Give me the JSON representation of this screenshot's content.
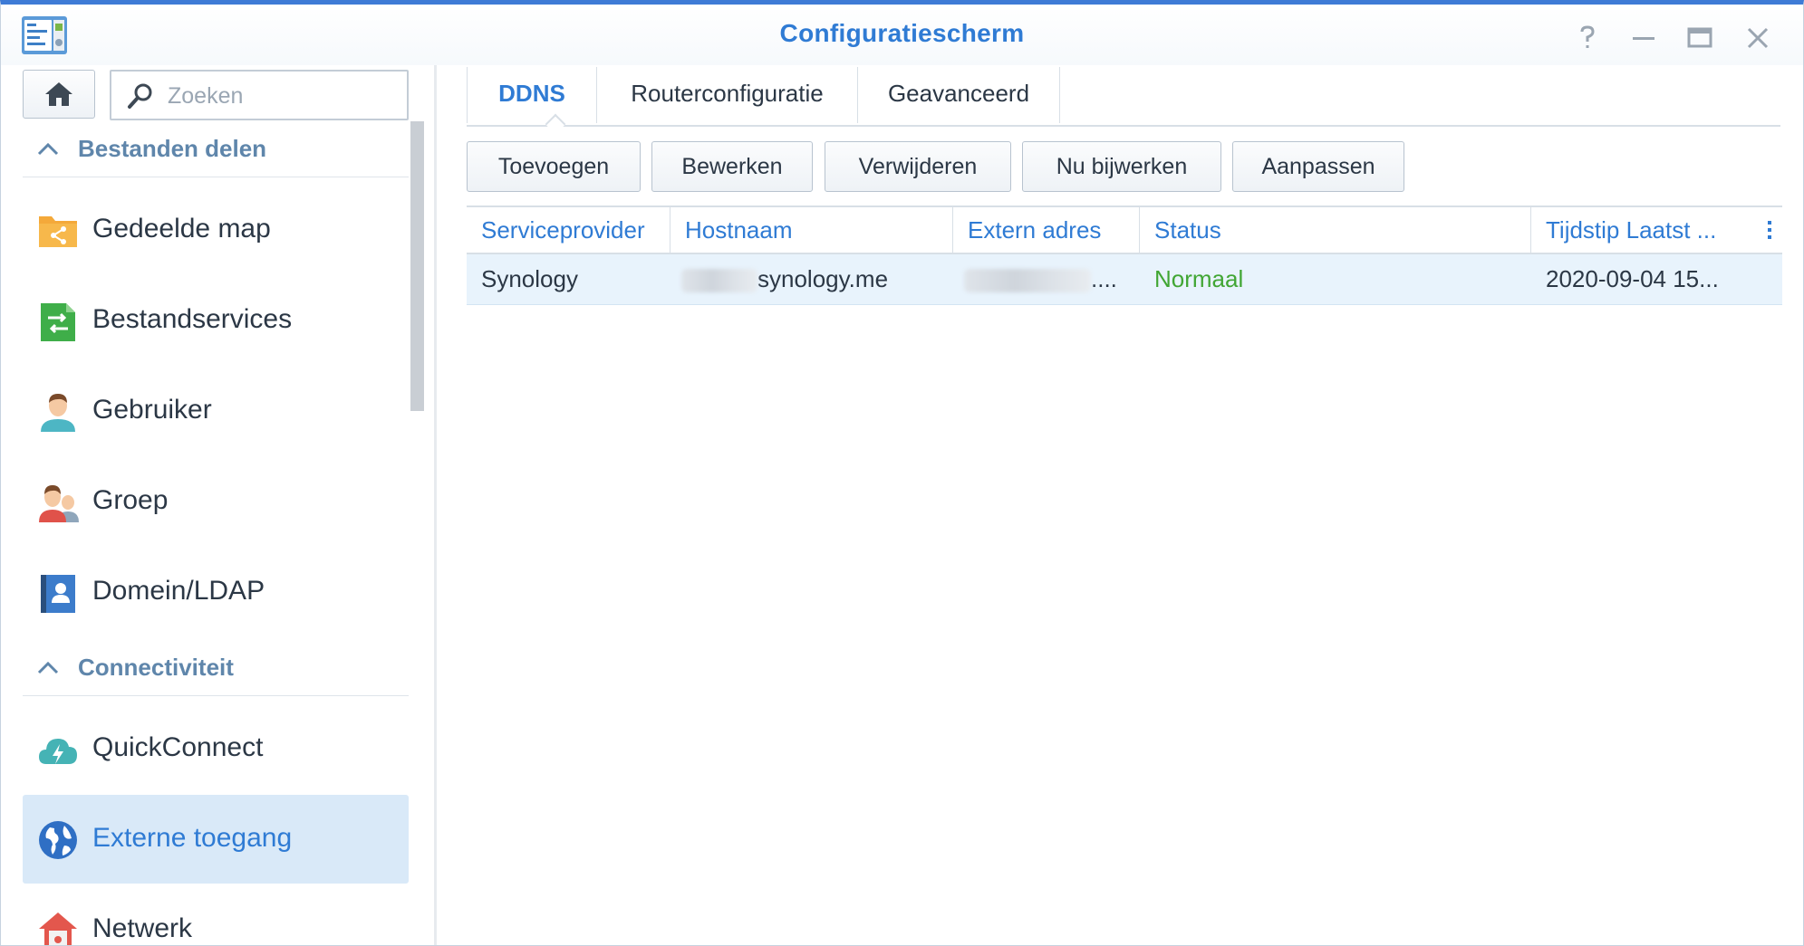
{
  "window": {
    "title": "Configuratiescherm",
    "controls": [
      "help-icon",
      "minimize-icon",
      "maximize-icon",
      "close-icon"
    ],
    "accent_color": "#2f7bd4",
    "frame_color": "#3e7bd6"
  },
  "sidebar": {
    "search_placeholder": "Zoeken",
    "sections": [
      {
        "label": "Bestanden delen",
        "items": [
          {
            "label": "Gedeelde map",
            "icon": "shared-folder-icon"
          },
          {
            "label": "Bestandservices",
            "icon": "file-services-icon"
          },
          {
            "label": "Gebruiker",
            "icon": "user-icon"
          },
          {
            "label": "Groep",
            "icon": "group-icon"
          },
          {
            "label": "Domein/LDAP",
            "icon": "domain-ldap-icon"
          }
        ]
      },
      {
        "label": "Connectiviteit",
        "items": [
          {
            "label": "QuickConnect",
            "icon": "quickconnect-icon"
          },
          {
            "label": "Externe toegang",
            "icon": "external-access-icon",
            "active": true
          },
          {
            "label": "Netwerk",
            "icon": "network-icon"
          }
        ]
      }
    ]
  },
  "main": {
    "tabs": [
      {
        "label": "DDNS",
        "active": true
      },
      {
        "label": "Routerconfiguratie"
      },
      {
        "label": "Geavanceerd"
      }
    ],
    "toolbar": {
      "add": "Toevoegen",
      "edit": "Bewerken",
      "delete": "Verwijderen",
      "update_now": "Nu bijwerken",
      "customize": "Aanpassen"
    },
    "table": {
      "columns": [
        "Serviceprovider",
        "Hostnaam",
        "Extern adres",
        "Status",
        "Tijdstip Laatst ..."
      ],
      "rows": [
        {
          "provider": "Synology",
          "hostname_suffix": "synology.me",
          "external_address_suffix": "....",
          "status": "Normaal",
          "last_updated": "2020-09-04 15..."
        }
      ],
      "status_color": "#41a634"
    }
  }
}
